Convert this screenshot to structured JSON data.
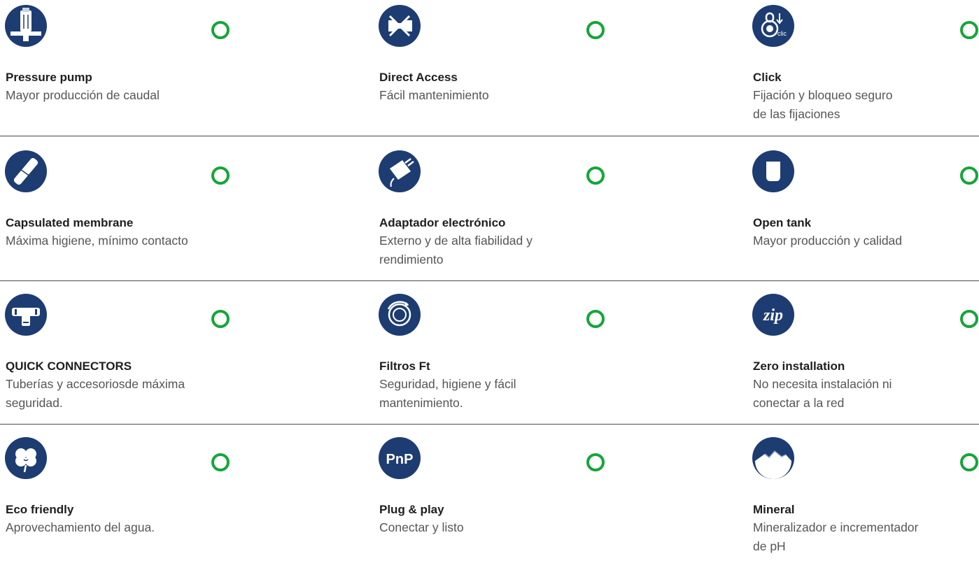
{
  "colors": {
    "icon_bg": "#1d3c72",
    "status_ring": "#16a53a",
    "divider": "#4a4a4a"
  },
  "rows": [
    [
      {
        "id": "pressure-pump",
        "icon": "pressure-pump-icon",
        "title": "Pressure pump",
        "desc": "Mayor producción de caudal"
      },
      {
        "id": "direct-access",
        "icon": "no-wrench-icon",
        "title": "Direct Access",
        "desc": "Fácil mantenimiento"
      },
      {
        "id": "click",
        "icon": "click-lock-icon",
        "title": "Click",
        "desc": "Fijación y bloqueo seguro\nde las fijaciones"
      }
    ],
    [
      {
        "id": "capsulated-membrane",
        "icon": "membrane-icon",
        "title": "Capsulated membrane",
        "desc": "Máxima higiene, mínimo contacto"
      },
      {
        "id": "adaptador-electronico",
        "icon": "power-adapter-icon",
        "title": "Adaptador electrónico",
        "desc": "Externo y de alta fiabilidad y\nrendimiento"
      },
      {
        "id": "open-tank",
        "icon": "tank-icon",
        "title": "Open tank",
        "desc": "Mayor producción y calidad"
      }
    ],
    [
      {
        "id": "quick-connectors",
        "icon": "tee-connector-icon",
        "title": "QUICK CONNECTORS",
        "desc": "Tuberías y accesoriosde máxima\nseguridad."
      },
      {
        "id": "filtros-ft",
        "icon": "rotating-filter-icon",
        "title": "Filtros Ft",
        "desc": "Seguridad, higiene y fácil\nmantenimiento."
      },
      {
        "id": "zero-installation",
        "icon": "zip-icon",
        "title": "Zero installation",
        "desc": "No necesita instalación ni\nconectar a la red"
      }
    ],
    [
      {
        "id": "eco-friendly",
        "icon": "clover-icon",
        "title": "Eco friendly",
        "desc": "Aprovechamiento del agua."
      },
      {
        "id": "plug-and-play",
        "icon": "pnp-icon",
        "title": "Plug & play",
        "desc": "Conectar y listo"
      },
      {
        "id": "mineral",
        "icon": "mountain-icon",
        "title": "Mineral",
        "desc": "Mineralizador e incrementador\nde pH"
      }
    ]
  ],
  "icon_text": {
    "pnp": "PnP",
    "zip": "zip",
    "clic": "clic"
  }
}
